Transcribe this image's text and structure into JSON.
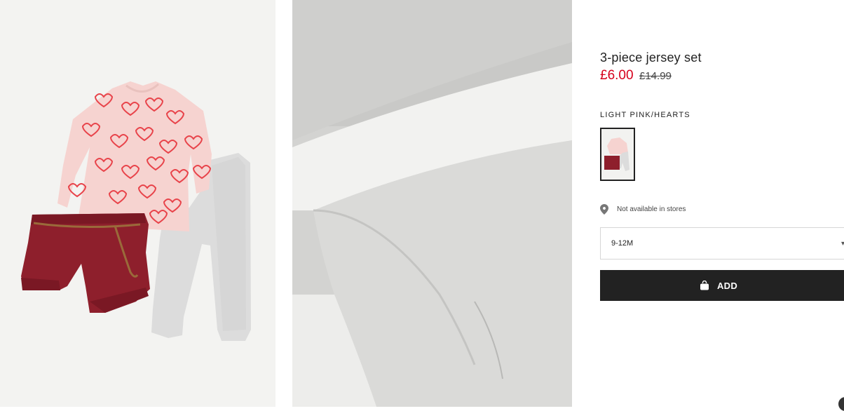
{
  "product": {
    "title": "3-piece jersey set",
    "price_current": "£6.00",
    "price_original": "£14.99",
    "color_name": "LIGHT PINK/HEARTS",
    "store_availability": "Not available in stores",
    "selected_size": "9-12M",
    "add_label": "ADD"
  },
  "colors": {
    "sale_red": "#d6001c",
    "button_black": "#222222",
    "shorts_burgundy": "#8e1f2c",
    "top_pink": "#f6d3d0",
    "heart_red": "#e8434a",
    "leggings_grey": "#d8d8d8"
  },
  "icons": {
    "location": "location-pin-icon",
    "bag": "shopping-bag-icon",
    "select": "chevron-down-icon"
  }
}
